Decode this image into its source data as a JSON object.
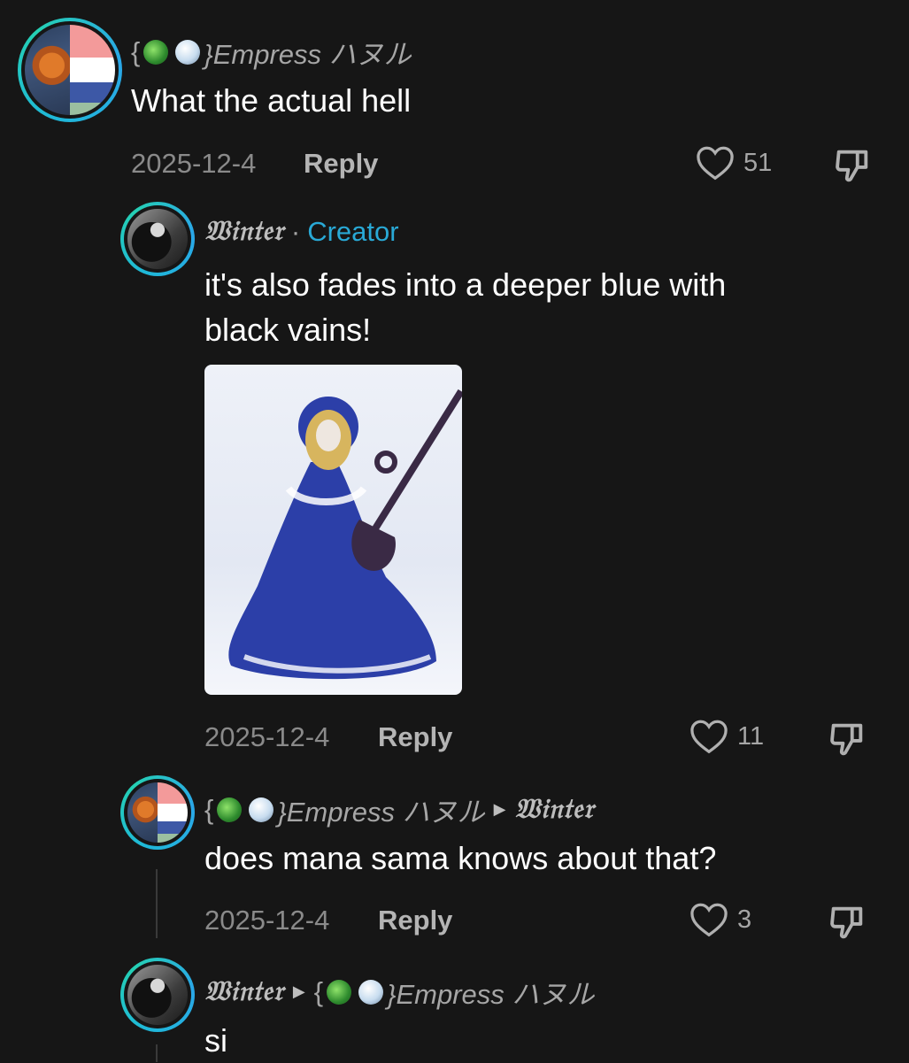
{
  "comments": [
    {
      "author_prefix": "{",
      "author_suffix": "}Empress ハヌル",
      "text": "What the actual hell",
      "date": "2025-12-4",
      "reply_label": "Reply",
      "likes": "51"
    },
    {
      "author": "𝔚𝔦𝔫𝔱𝔢𝔯",
      "separator": "·",
      "badge": "Creator",
      "text_line1": "it's also fades into a deeper blue with",
      "text_line2": "black vains!",
      "date": "2025-12-4",
      "reply_label": "Reply",
      "likes": "11"
    },
    {
      "author_prefix": "{",
      "author_suffix": "}Empress ハヌル",
      "reply_to": "𝔚𝔦𝔫𝔱𝔢𝔯",
      "text": "does mana sama knows about that?",
      "date": "2025-12-4",
      "reply_label": "Reply",
      "likes": "3"
    },
    {
      "author": "𝔚𝔦𝔫𝔱𝔢𝔯",
      "reply_to_prefix": "{",
      "reply_to_suffix": "}Empress ハヌル",
      "text": "si"
    }
  ],
  "colors": {
    "background": "#161616",
    "creator_badge": "#29a9d6",
    "avatar_ring": "#1fb8d8"
  }
}
